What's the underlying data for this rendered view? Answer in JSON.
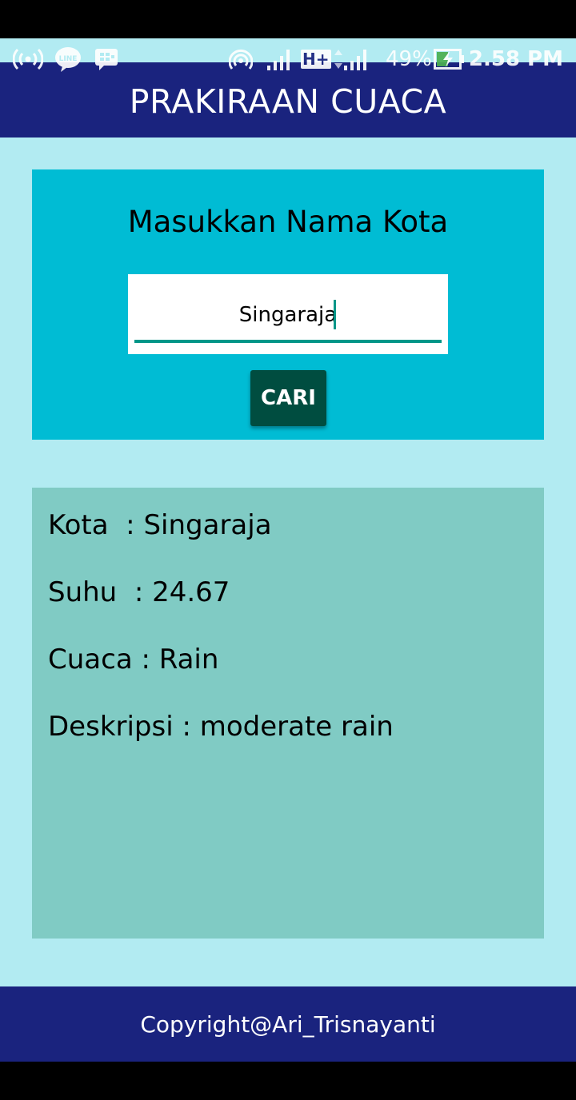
{
  "status_bar": {
    "icons": [
      "hotspot-icon",
      "line-icon",
      "bbm-icon",
      "cast-icon",
      "signal-icon",
      "h-plus-icon",
      "signal-icon-2",
      "battery-charging-icon"
    ],
    "h_plus_label": "H+",
    "line_label": "LINE",
    "battery_percent": "49%",
    "time": "2.58 PM"
  },
  "app_bar": {
    "title": "PRAKIRAAN CUACA",
    "color": "#1A237E"
  },
  "search": {
    "heading": "Masukkan Nama Kota",
    "input_value": "Singaraja",
    "button_label": "CARI",
    "card_color": "#00BCD4",
    "button_color": "#004D40",
    "accent_color": "#009688"
  },
  "result": {
    "card_color": "#80CBC4",
    "kota": "Kota  : Singaraja",
    "suhu": "Suhu  : 24.67",
    "cuaca": "Cuaca : Rain",
    "deskripsi": "Deskripsi : moderate rain"
  },
  "footer": {
    "text": "Copyright@Ari_Trisnayanti"
  },
  "background_color": "#B2EBF2"
}
